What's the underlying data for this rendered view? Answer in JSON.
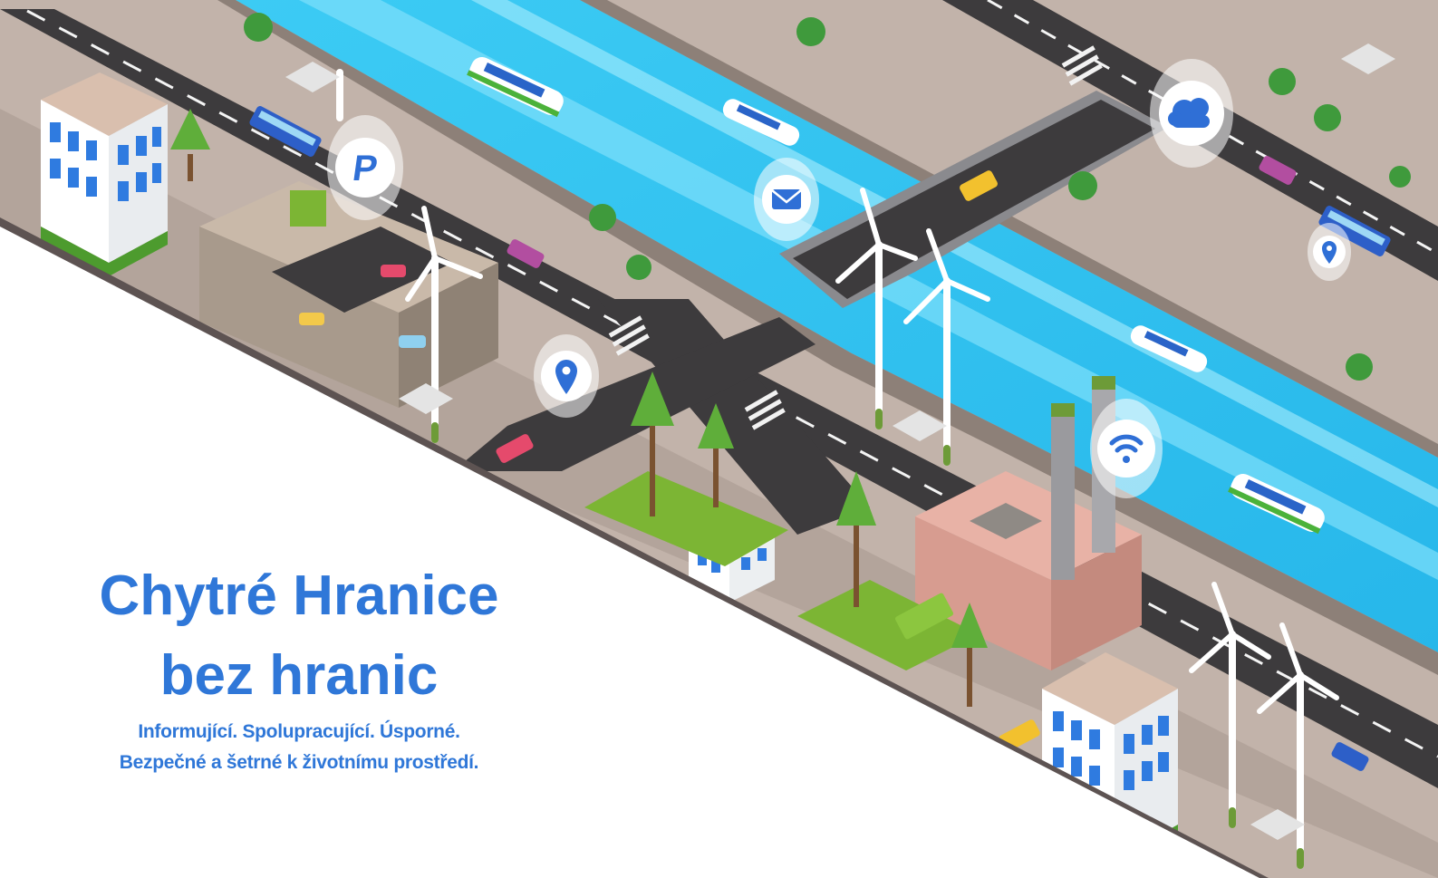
{
  "headline": {
    "line1": "Chytré Hranice",
    "line2": "bez hranic"
  },
  "subheadline": {
    "line1": "Informující. Spolupracující.  Úsporné.",
    "line2": "Bezpečné a šetrné k životnímu prostředí."
  },
  "colors": {
    "headline": "#2f77d8",
    "river": "#35c4f0",
    "road": "#3d3b3d",
    "ground": "#bdaea6",
    "grass": "#7cb534",
    "icon_bubble": "#2f6fd6"
  },
  "icons": [
    "parking-icon",
    "location-pin-icon",
    "mail-icon",
    "cloud-icon",
    "wifi-icon",
    "location-pin-icon"
  ]
}
